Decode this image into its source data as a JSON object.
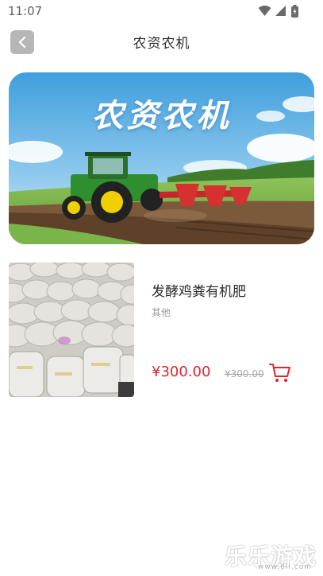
{
  "status_bar": {
    "time": "11:07"
  },
  "header": {
    "title": "农资农机",
    "back_icon": "chevron-left-icon"
  },
  "banner": {
    "text": "农资农机"
  },
  "products": [
    {
      "name": "发酵鸡粪有机肥",
      "category": "其他",
      "price": "¥300.00",
      "original_price": "¥300.00",
      "cart_icon": "shopping-cart-icon"
    }
  ],
  "watermark": {
    "text": "乐乐游戏",
    "url": "www.6ll.com"
  },
  "colors": {
    "price_red": "#e0262a",
    "back_button_bg": "#b6b6b6",
    "title_text": "#2d2d2d"
  }
}
